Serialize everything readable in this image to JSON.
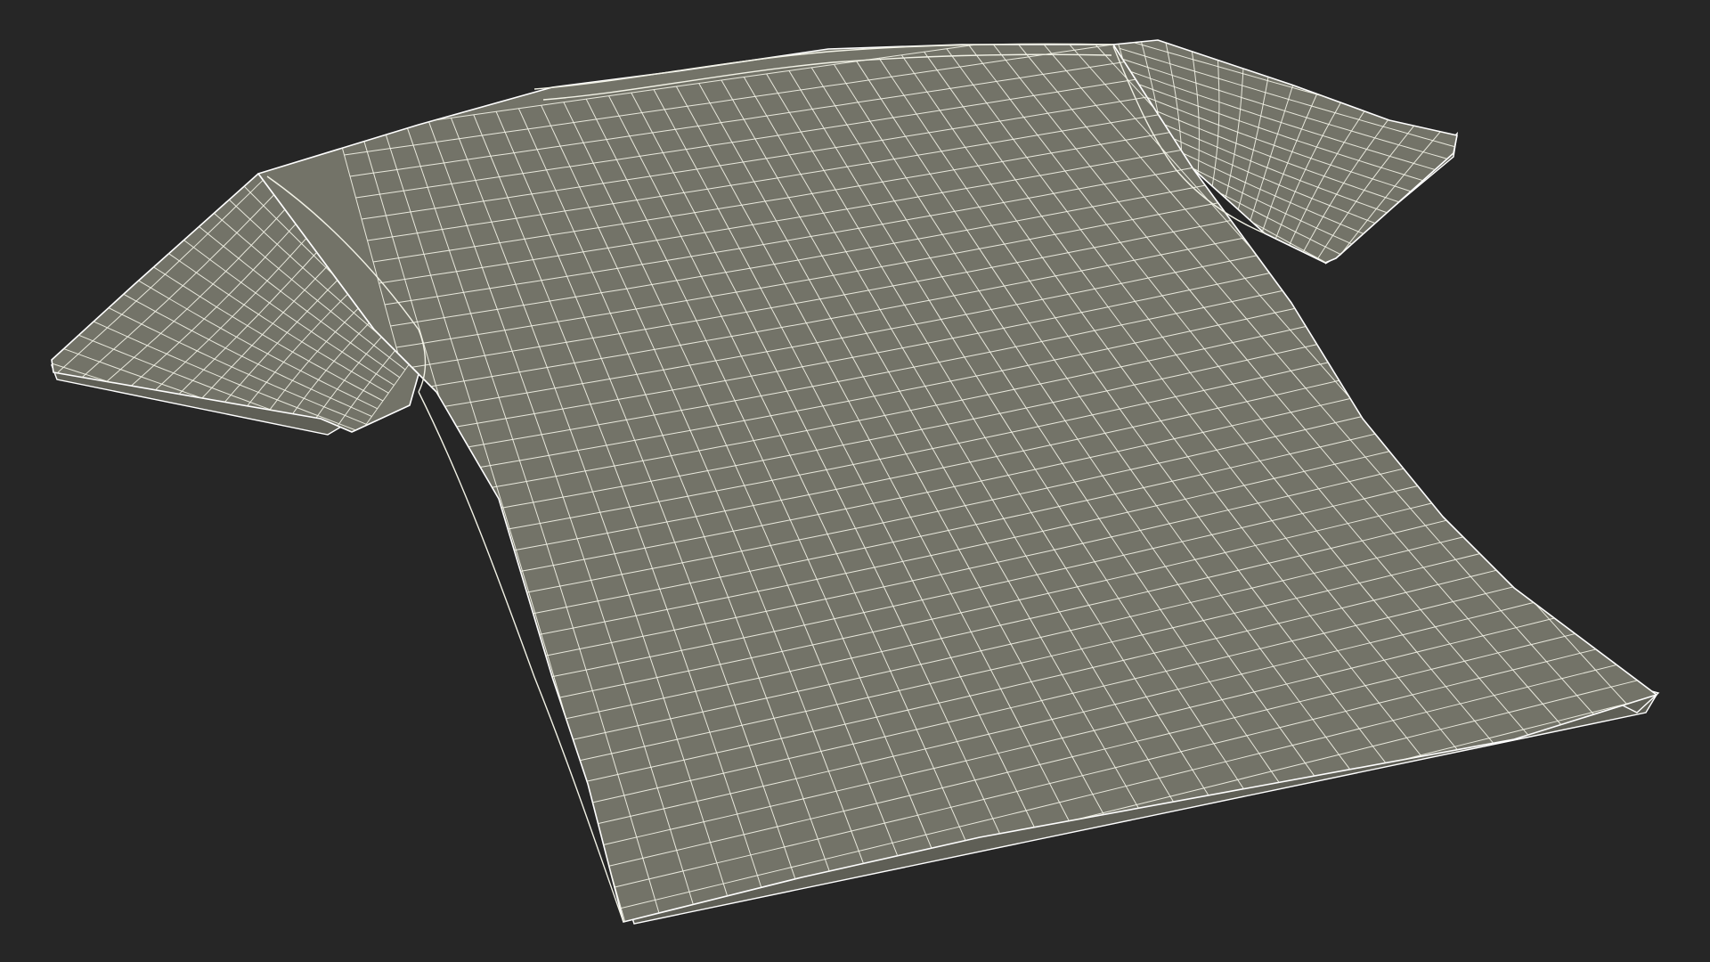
{
  "scene": {
    "background_color": "#262626",
    "object": "t-shirt-wireframe",
    "shading": "wireframe",
    "surface_color": "#737368",
    "inner_fold_color": "#5f5f56",
    "wire_color": "#f2f2e6",
    "edge_color": "#ffffff"
  }
}
